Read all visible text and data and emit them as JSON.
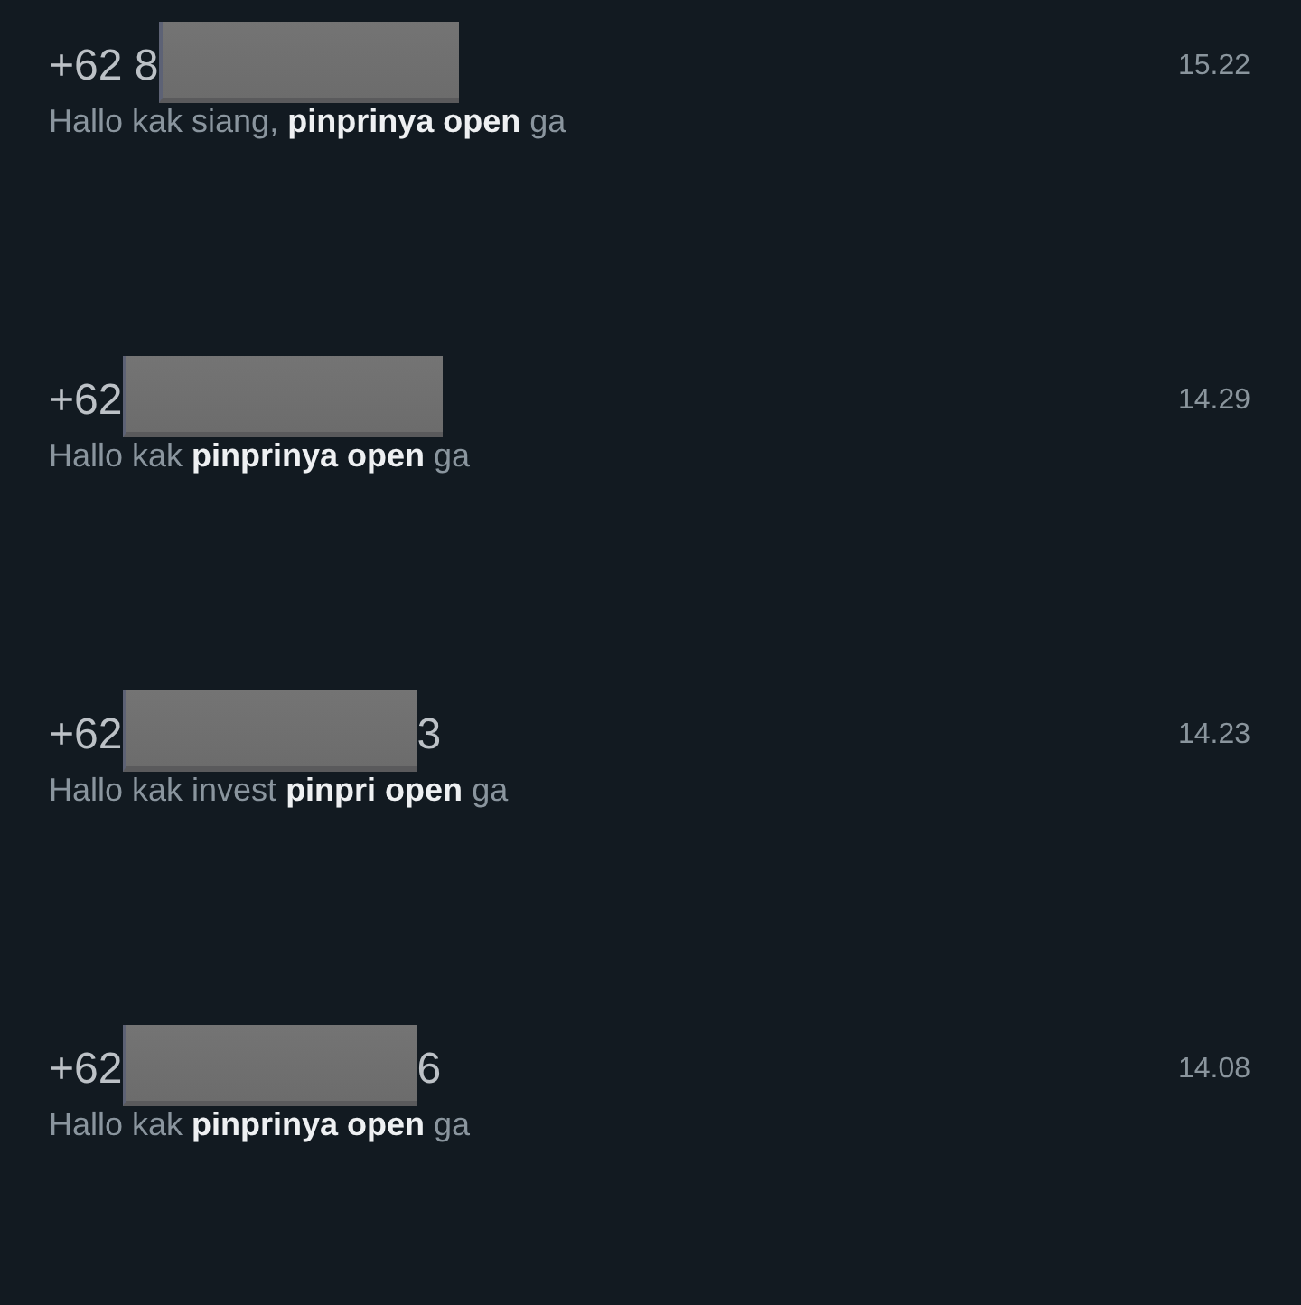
{
  "chats": [
    {
      "number_start": "+62 8",
      "redacted": true,
      "time": "15.22",
      "message": "Hallo kak siang, **pinprinya open** ga"
    },
    {
      "number_start": "+62",
      "redacted": true,
      "time": "14.29",
      "message": "Hallo kak **pinprinya open** ga"
    },
    {
      "number_start": "+62",
      "redacted": true,
      "number_end": "3",
      "time": "14.23",
      "message": "Hallo kak invest **pinpri open** ga"
    },
    {
      "number_start": "+62",
      "redacted": true,
      "number_end": "6",
      "time": "14.08",
      "message": "Hallo kak **pinprinya open** ga"
    }
  ]
}
